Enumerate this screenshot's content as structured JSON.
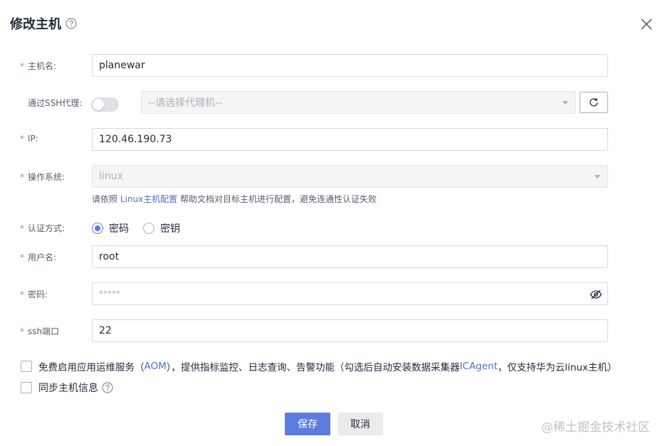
{
  "dialog": {
    "title": "修改主机"
  },
  "form": {
    "hostname": {
      "label": "主机名:",
      "value": "planewar"
    },
    "ssh_proxy": {
      "label": "通过SSH代理:",
      "enabled": false,
      "placeholder": "--请选择代理机--"
    },
    "ip": {
      "label": "IP:",
      "value": "120.46.190.73"
    },
    "os": {
      "label": "操作系统:",
      "value": "linux"
    },
    "os_hint": {
      "before": "请依照 ",
      "link": "Linux主机配置",
      "after": " 帮助文档对目标主机进行配置，避免连通性认证失败"
    },
    "auth": {
      "label": "认证方式:",
      "options": [
        "密码",
        "密钥"
      ],
      "selected": "密码"
    },
    "username": {
      "label": "用户名:",
      "value": "root"
    },
    "password": {
      "label": "密码:",
      "value": "*****"
    },
    "ssh_port": {
      "label": "ssh端口",
      "value": "22"
    },
    "aom": {
      "text_before": "免费启用应用运维服务（",
      "link1": "AOM",
      "text_middle": "），提供指标监控、日志查询、告警功能（勾选后自动安装数据采集器 ",
      "link2": "ICAgent",
      "text_after": "，仅支持华为云linux主机）",
      "checked": false
    },
    "sync": {
      "label": "同步主机信息",
      "checked": false
    }
  },
  "required_mark": "*",
  "footer": {
    "save_label": "保存",
    "cancel_label": "取消"
  },
  "watermark": "@稀土掘金技术社区",
  "colors": {
    "primary": "#5e7ce0",
    "required": "#f66f6a",
    "link": "#526ecc"
  }
}
